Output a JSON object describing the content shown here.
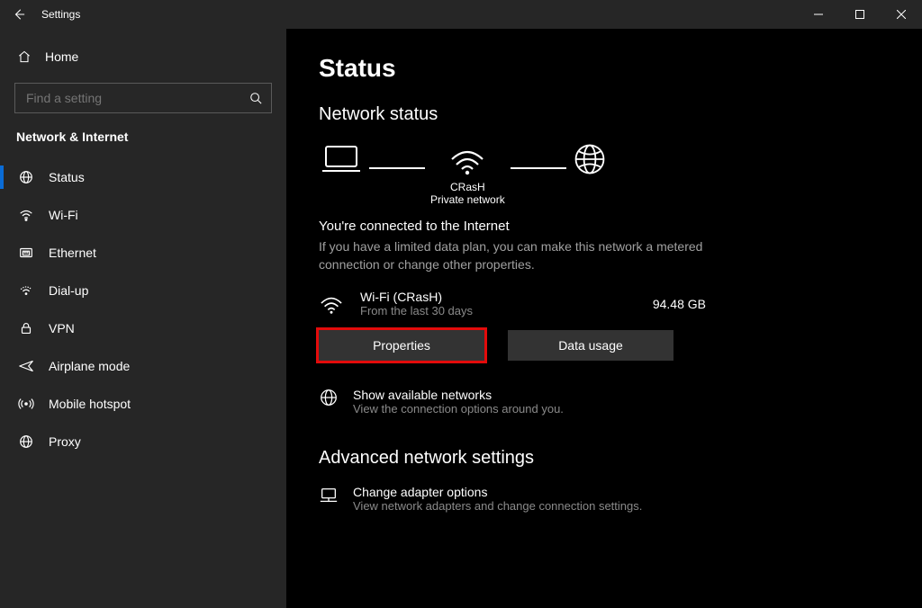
{
  "window": {
    "title": "Settings"
  },
  "sidebar": {
    "home": "Home",
    "search_placeholder": "Find a setting",
    "section": "Network & Internet",
    "items": [
      {
        "label": "Status"
      },
      {
        "label": "Wi-Fi"
      },
      {
        "label": "Ethernet"
      },
      {
        "label": "Dial-up"
      },
      {
        "label": "VPN"
      },
      {
        "label": "Airplane mode"
      },
      {
        "label": "Mobile hotspot"
      },
      {
        "label": "Proxy"
      }
    ]
  },
  "main": {
    "heading": "Status",
    "subheading": "Network status",
    "diagram": {
      "ssid": "CRasH",
      "net_type": "Private network"
    },
    "status_title": "You're connected to the Internet",
    "status_desc": "If you have a limited data plan, you can make this network a metered connection or change other properties.",
    "connection": {
      "name": "Wi-Fi (CRasH)",
      "period": "From the last 30 days",
      "usage": "94.48 GB"
    },
    "buttons": {
      "properties": "Properties",
      "data_usage": "Data usage"
    },
    "show_networks": {
      "title": "Show available networks",
      "desc": "View the connection options around you."
    },
    "advanced_heading": "Advanced network settings",
    "adapter_options": {
      "title": "Change adapter options",
      "desc": "View network adapters and change connection settings."
    }
  }
}
